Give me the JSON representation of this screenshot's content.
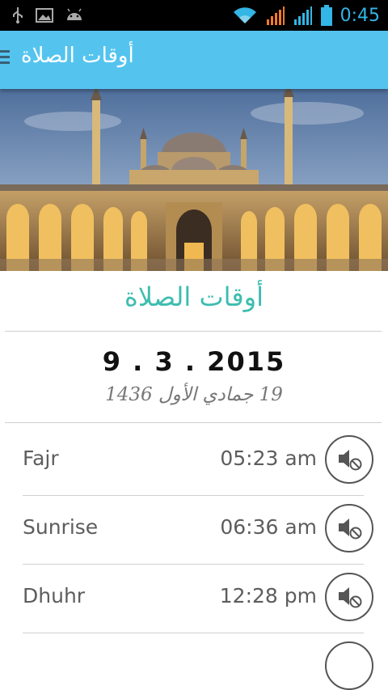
{
  "status_bar": {
    "time": "0:45",
    "icons": [
      "usb-icon",
      "image-icon",
      "android-icon",
      "wifi-icon",
      "signal-icon",
      "signal-icon",
      "battery-icon"
    ]
  },
  "app_bar": {
    "title": "أوقات الصلاة",
    "menu_icon": "hamburger-icon"
  },
  "hero": {
    "image": "mosque-photo"
  },
  "content": {
    "section_title": "أوقات الصلاة",
    "gregorian_date": "9 . 3 . 2015",
    "hijri_date": "19 جمادي الأول 1436"
  },
  "prayers": [
    {
      "name": "Fajr",
      "time": "05:23 am",
      "icon": "mute-speaker-icon"
    },
    {
      "name": "Sunrise",
      "time": "06:36 am",
      "icon": "mute-speaker-icon"
    },
    {
      "name": "Dhuhr",
      "time": "12:28 pm",
      "icon": "mute-speaker-icon"
    }
  ],
  "colors": {
    "app_bar": "#54c4ef",
    "section_title": "#3dbdb0",
    "status_time": "#33b5e5"
  }
}
